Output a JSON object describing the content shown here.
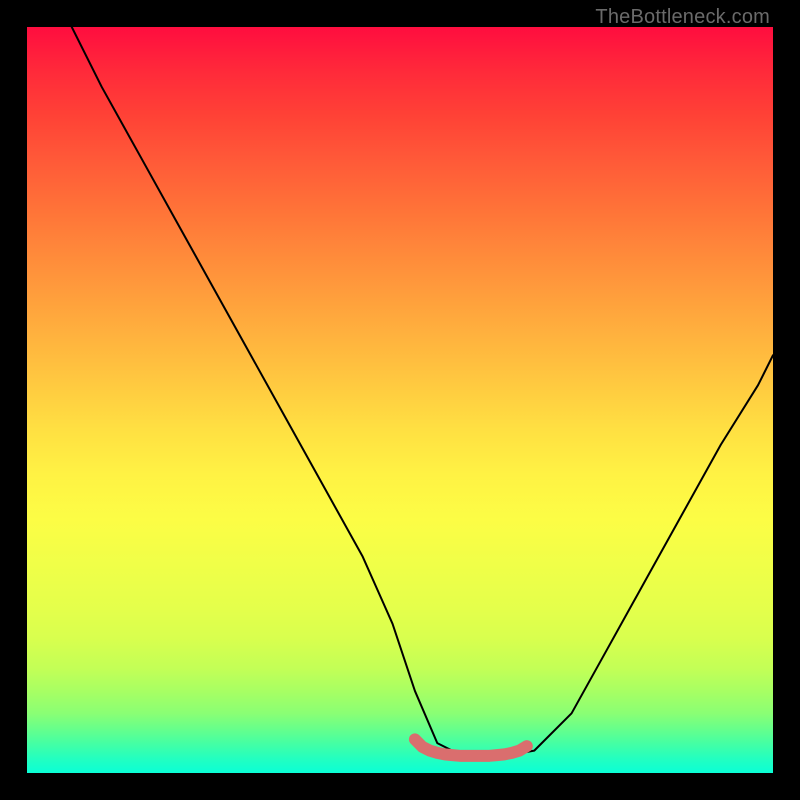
{
  "watermark": "TheBottleneck.com",
  "chart_data": {
    "type": "line",
    "title": "",
    "xlabel": "",
    "ylabel": "",
    "xlim": [
      0,
      100
    ],
    "ylim": [
      0,
      100
    ],
    "series": [
      {
        "name": "black-curve",
        "x": [
          6,
          10,
          15,
          20,
          25,
          30,
          35,
          40,
          45,
          49,
          52,
          55,
          58,
          61,
          64,
          68,
          73,
          78,
          83,
          88,
          93,
          98,
          100
        ],
        "values": [
          100,
          92,
          83,
          74,
          65,
          56,
          47,
          38,
          29,
          20,
          11,
          4,
          2.5,
          2.3,
          2.3,
          3,
          8,
          17,
          26,
          35,
          44,
          52,
          56
        ]
      },
      {
        "name": "pink-highlight",
        "x": [
          52,
          53,
          54,
          55,
          56,
          57,
          58,
          59,
          60,
          61,
          62,
          63,
          64,
          65,
          66,
          67
        ],
        "values": [
          4.5,
          3.5,
          3.0,
          2.7,
          2.5,
          2.4,
          2.3,
          2.3,
          2.3,
          2.3,
          2.3,
          2.4,
          2.5,
          2.7,
          3.0,
          3.6
        ]
      }
    ],
    "colors": {
      "black_curve": "#000000",
      "pink_highlight": "#da6e6e",
      "gradient_top": "#ff0d3f",
      "gradient_bottom": "#0affd6"
    }
  }
}
